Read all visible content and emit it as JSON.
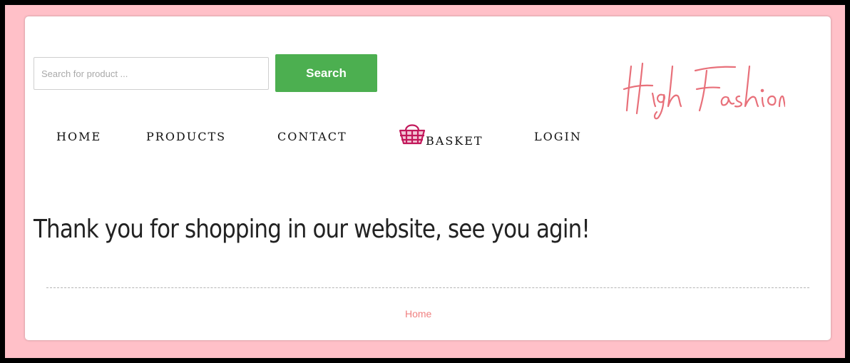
{
  "search": {
    "placeholder": "Search for product ...",
    "value": "",
    "button_label": "Search",
    "button_color": "#4caf50"
  },
  "brand": {
    "logo_text": "High Fashion",
    "color": "#e8707a"
  },
  "nav": {
    "items": [
      {
        "label": "HOME"
      },
      {
        "label": "PRODUCTS"
      },
      {
        "label": "CONTACT"
      },
      {
        "label": "BASKET",
        "icon": "basket-icon"
      },
      {
        "label": "LOGIN"
      }
    ]
  },
  "main": {
    "message": "Thank you for shopping in our website, see you agin!"
  },
  "footer": {
    "breadcrumb": "Home",
    "breadcrumb_color": "#f08080"
  },
  "theme": {
    "frame_color": "#ffc0c8",
    "basket_icon_color": "#c2185b"
  }
}
